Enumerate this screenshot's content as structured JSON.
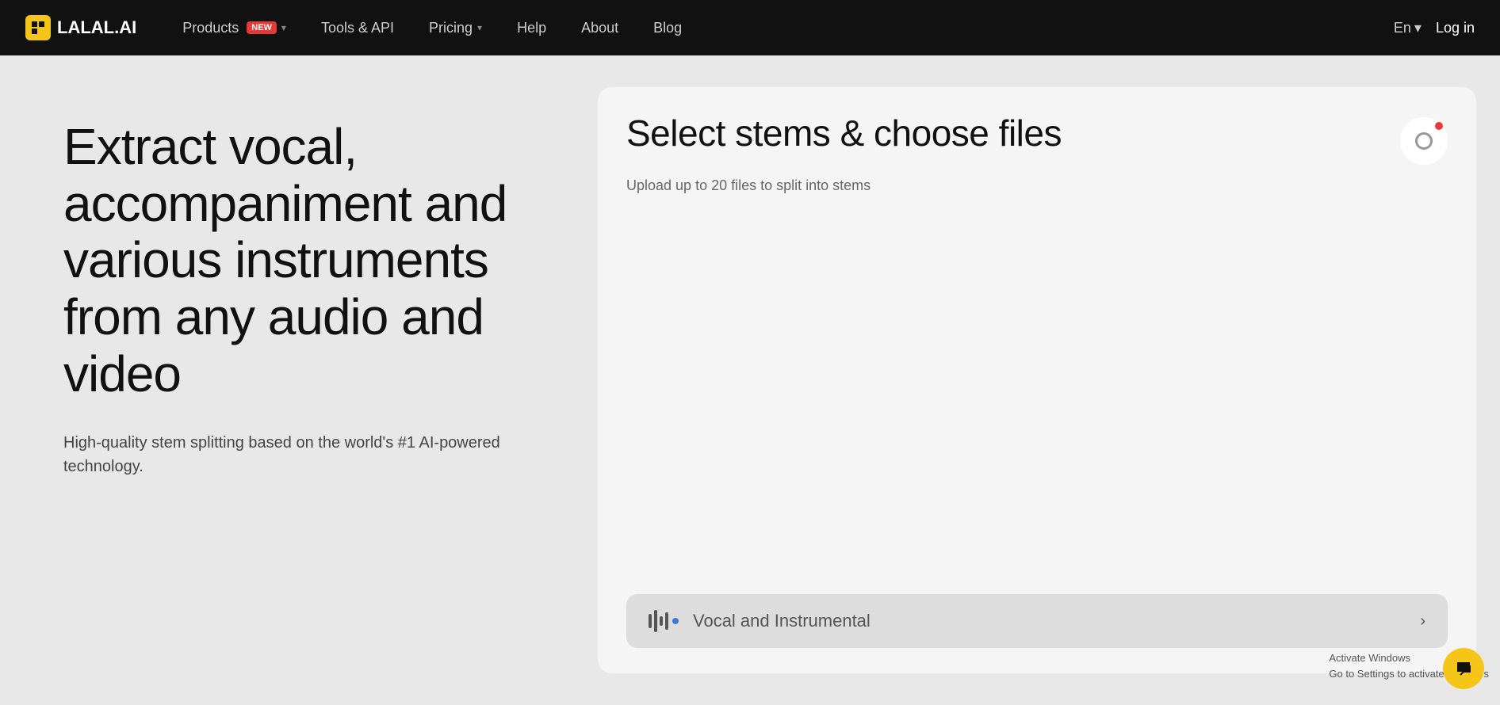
{
  "nav": {
    "logo_text": "LALAL.AI",
    "logo_icon": "■",
    "items": [
      {
        "id": "products",
        "label": "Products",
        "badge": "NEW",
        "has_dropdown": true
      },
      {
        "id": "tools",
        "label": "Tools & API",
        "has_dropdown": false
      },
      {
        "id": "pricing",
        "label": "Pricing",
        "has_dropdown": true
      },
      {
        "id": "help",
        "label": "Help",
        "has_dropdown": false
      },
      {
        "id": "about",
        "label": "About",
        "has_dropdown": false
      },
      {
        "id": "blog",
        "label": "Blog",
        "has_dropdown": false
      }
    ],
    "lang": "En",
    "login": "Log in"
  },
  "hero": {
    "title": "Extract vocal, accompaniment and various instruments from any audio and video",
    "subtitle": "High-quality stem splitting based on the world's #1 AI-powered technology."
  },
  "panel": {
    "title": "Select stems & choose files",
    "subtitle": "Upload up to 20 files to split into stems",
    "stem_option": "Vocal and Instrumental"
  },
  "windows_activation": {
    "line1": "Activate Windows",
    "line2": "Go to Settings to activate Windows"
  }
}
